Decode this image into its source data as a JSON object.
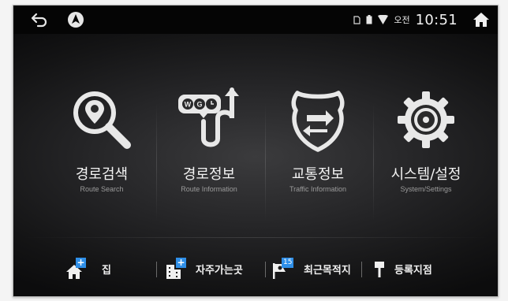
{
  "statusbar": {
    "back_icon": "back-arrow-icon",
    "nav_icon": "navigation-arrow-icon",
    "sd_icon": "sd-card-icon",
    "battery_icon": "battery-icon",
    "signal_icon": "wifi-signal-icon",
    "ampm": "오전",
    "time": "10:51",
    "home_icon": "home-icon"
  },
  "menu": {
    "items": [
      {
        "label": "경로검색",
        "sub": "Route Search",
        "icon": "route-search-icon"
      },
      {
        "label": "경로정보",
        "sub": "Route Information",
        "icon": "route-information-icon"
      },
      {
        "label": "교통정보",
        "sub": "Traffic Information",
        "icon": "traffic-information-icon"
      },
      {
        "label": "시스템/설정",
        "sub": "System/Settings",
        "icon": "settings-gear-icon"
      }
    ]
  },
  "bottom": {
    "items": [
      {
        "label": "집",
        "icon": "home-add-icon",
        "badge": "+"
      },
      {
        "label": "자주가는곳",
        "icon": "building-add-icon",
        "badge": "+"
      },
      {
        "label": "최근목적지",
        "icon": "recent-destination-flag-icon",
        "badge": "15"
      },
      {
        "label": "등록지점",
        "icon": "pin-icon"
      }
    ]
  },
  "colors": {
    "accent": "#2f8fe8",
    "statusbar_bg": "#050505",
    "screen_bg": "#1a1a1b",
    "text": "#f3f3f3",
    "subtext": "#9b9b9b"
  }
}
